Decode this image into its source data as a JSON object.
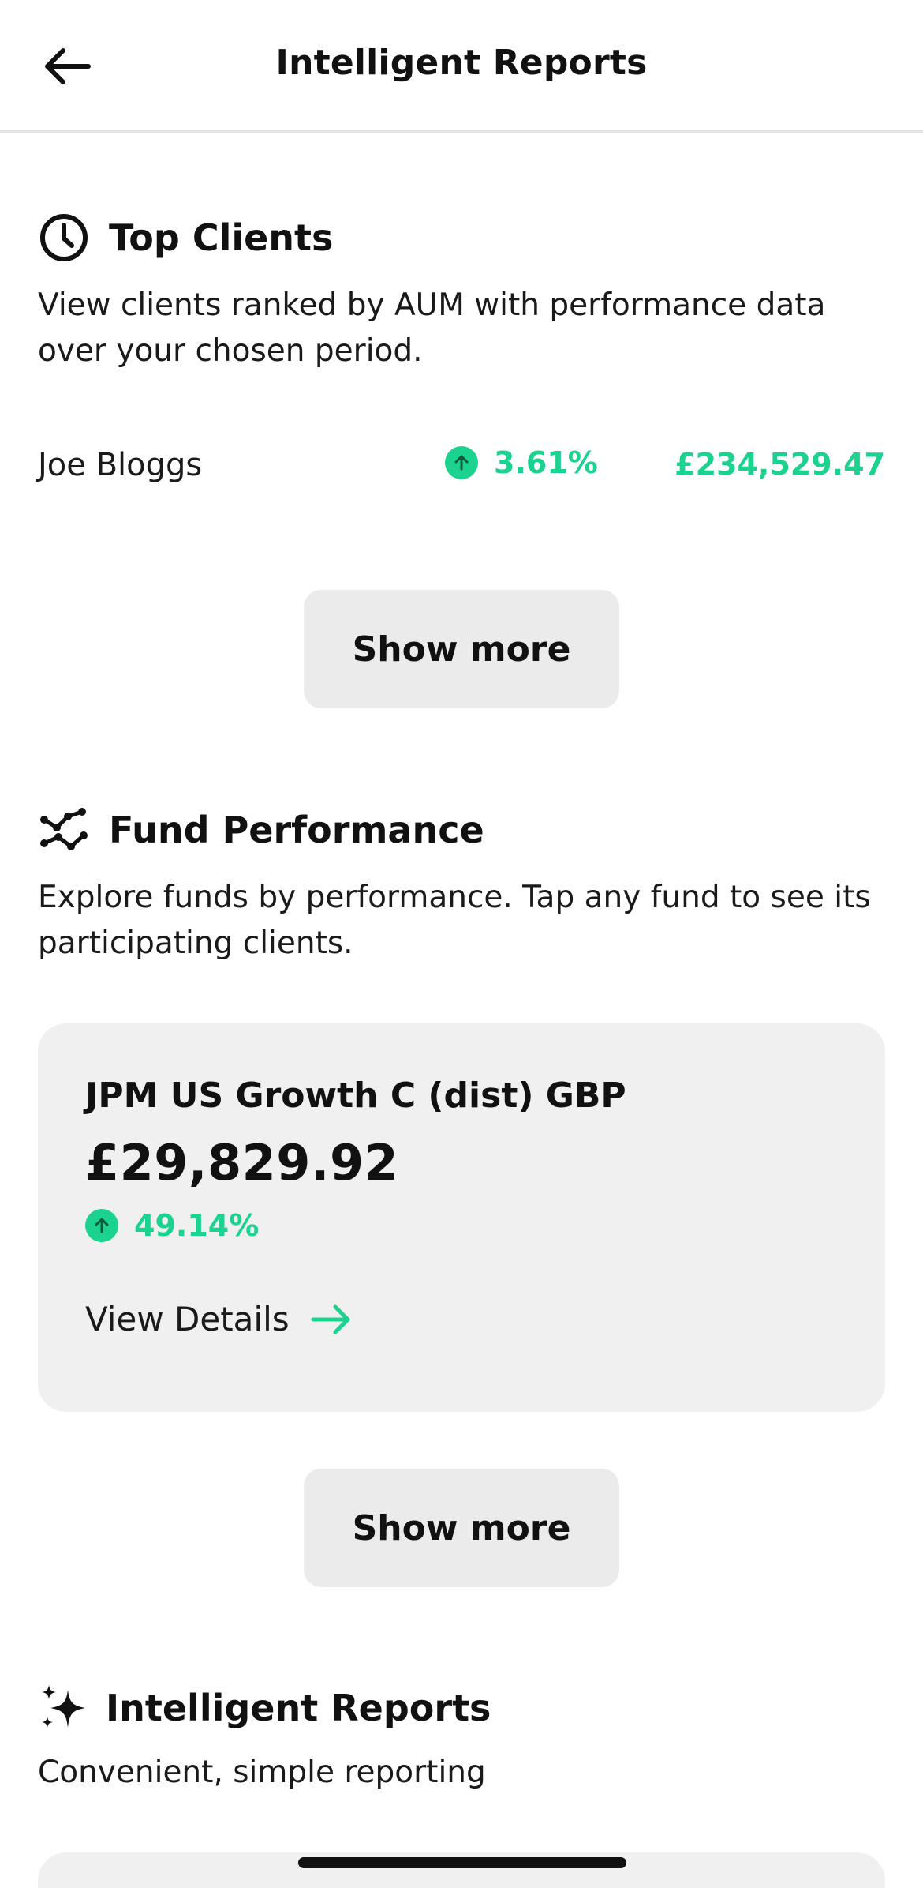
{
  "header": {
    "title": "Intelligent Reports",
    "back_icon": "arrow-left-icon"
  },
  "top_clients": {
    "icon": "clock-icon",
    "title": "Top Clients",
    "description": "View clients ranked by AUM with performance data over your chosen period.",
    "clients": [
      {
        "name": "Joe Bloggs",
        "change": "3.61%",
        "aum": "£234,529.47",
        "trend": "up"
      }
    ],
    "show_more_label": "Show more"
  },
  "fund_performance": {
    "icon": "chart-network-icon",
    "title": "Fund Performance",
    "description": "Explore funds by performance. Tap any fund to see its participating clients.",
    "funds": [
      {
        "name": "JPM US Growth C (dist) GBP",
        "value": "£29,829.92",
        "change": "49.14%",
        "trend": "up",
        "details_label": "View Details"
      }
    ],
    "show_more_label": "Show more"
  },
  "intelligent_reports": {
    "icon": "sparkles-icon",
    "title": "Intelligent Reports",
    "description": "Convenient, simple reporting"
  },
  "colors": {
    "positive": "#1bd38f",
    "button_bg": "#ebebeb",
    "card_bg": "#f0f0f0",
    "text": "#111111"
  }
}
